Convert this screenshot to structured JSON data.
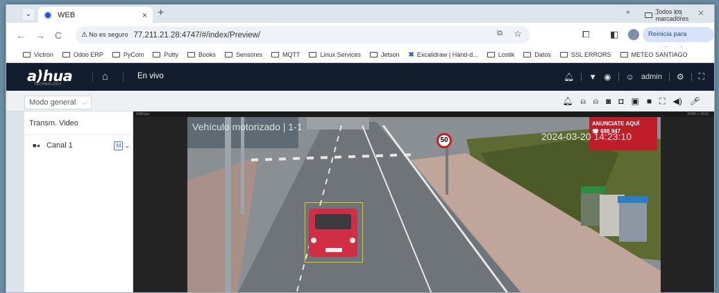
{
  "browser": {
    "tab_title": "WEB",
    "tab_close": "×",
    "new_tab": "+",
    "window_controls": [
      "–",
      "▢",
      "✕"
    ],
    "nav_back": "←",
    "nav_forward": "→",
    "nav_reload": "C",
    "security_label": "No es seguro",
    "url": "77.211.21.28:4747/#/index/Preview/",
    "update_button": "Reinicia para actualizar",
    "bookmarks": [
      "Victron",
      "Odoo ERP",
      "PyCom",
      "Putty",
      "Books",
      "Sensores",
      "MQTT",
      "Linux Services",
      "Jetson",
      "Excalidraw | Hand-d...",
      "Lostik",
      "Datos",
      "SSL ERRORS",
      "METEO SANTIAGO"
    ],
    "bookmarks_more": "»",
    "all_bookmarks": "Todos los marcadores"
  },
  "app": {
    "logo": "a)hua",
    "logo_sub": "TECHNOLOGY",
    "section": "En vivo",
    "user": "admin"
  },
  "toolbar": {
    "view_mode": "Modo general"
  },
  "sidebar": {
    "title": "Transm. Video",
    "channels": [
      {
        "label": "Canal 1",
        "badge": "M"
      }
    ]
  },
  "video": {
    "bitrate": "198kbps",
    "resolution": "2688 × 1520",
    "osd_title": "Vehículo motorizado | 1-1",
    "osd_time": "2024-03-20 14:23:10",
    "speed_sign": "50",
    "billboard_line1": "ANUNCIATE AQUÍ",
    "billboard_line2": "☎ 698 947"
  },
  "colors": {
    "header_bg": "#121d2d",
    "accent_blue": "#3d7bd8",
    "detection_box": "#d2cf1f"
  }
}
